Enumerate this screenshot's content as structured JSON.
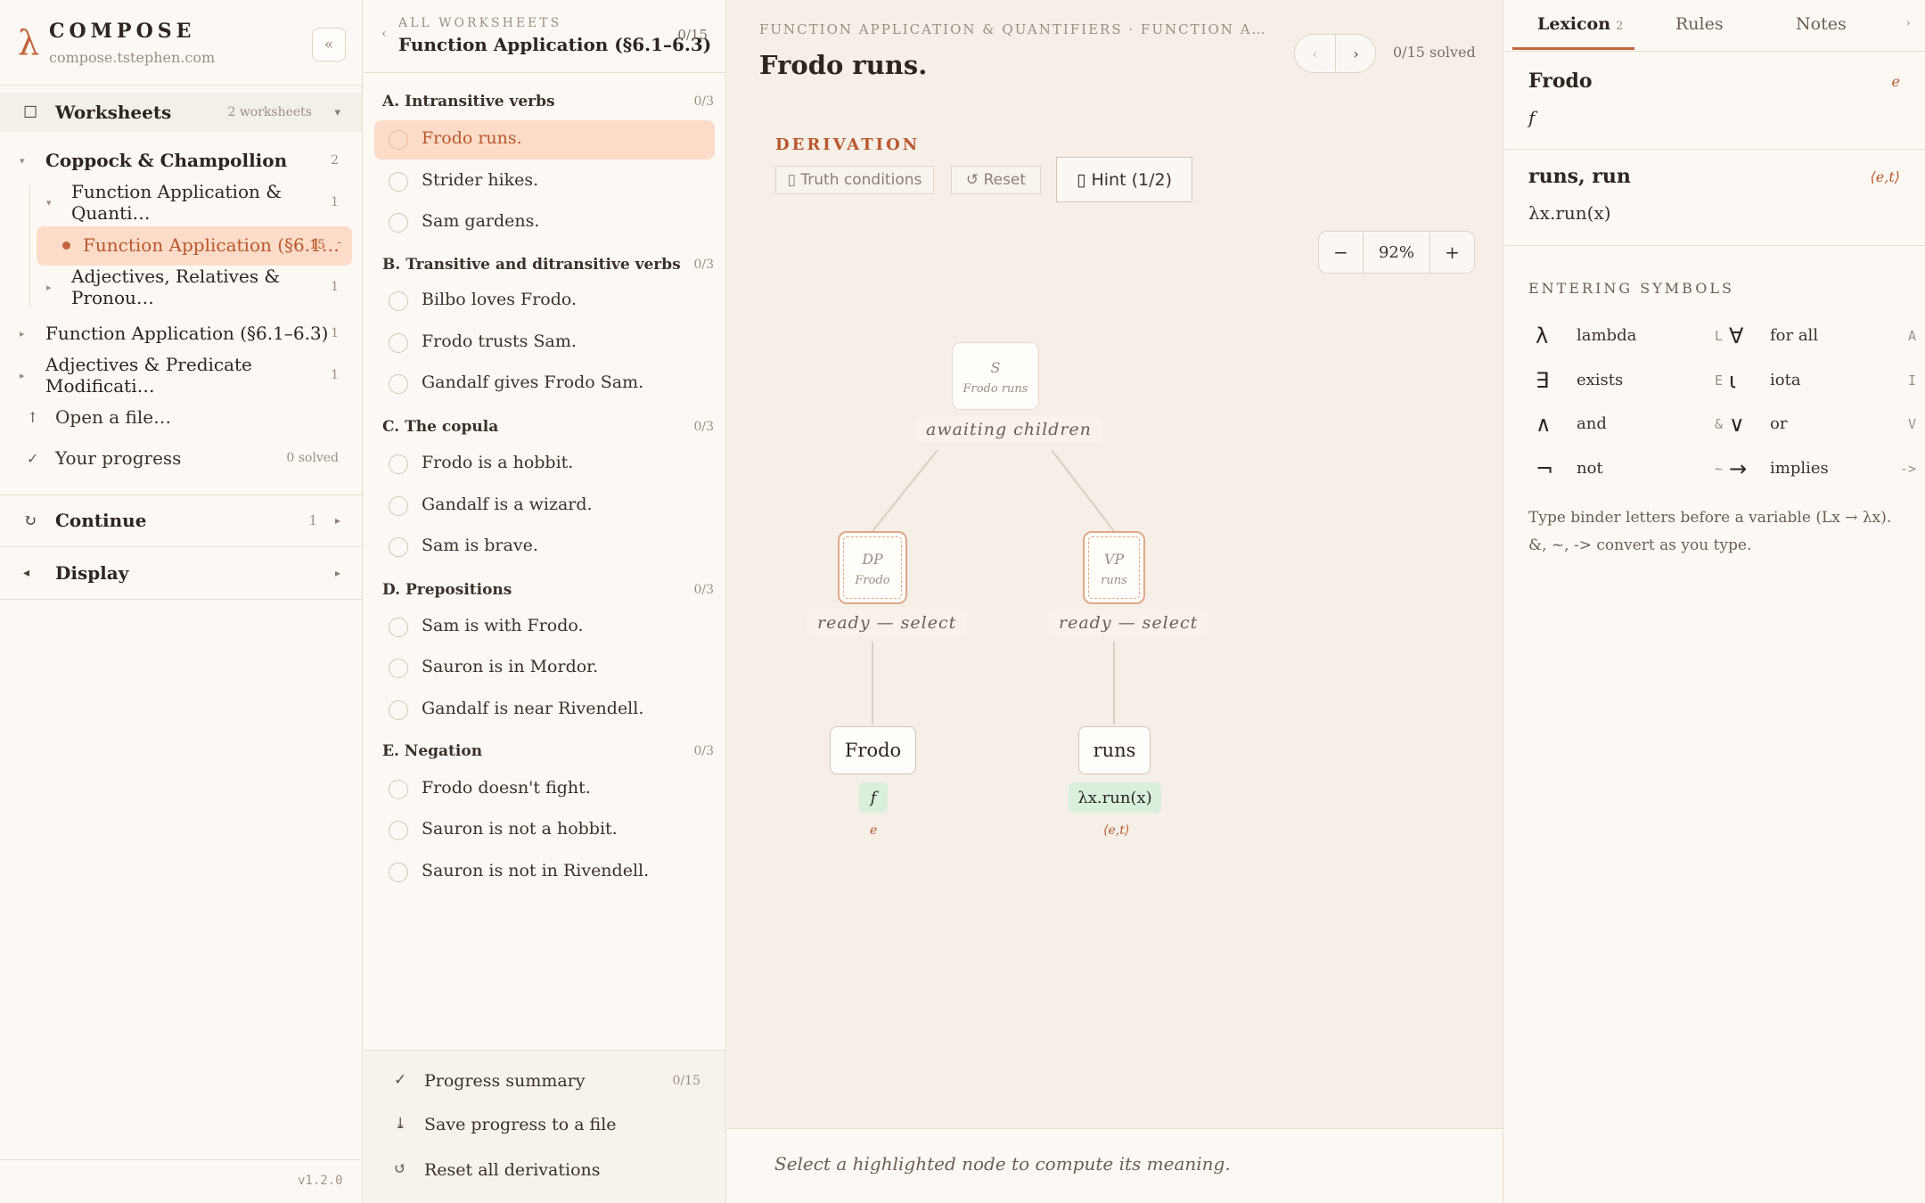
{
  "sidebar": {
    "brand": {
      "logo": "λ",
      "name": "COMPOSE",
      "url": "compose.tstephen.com",
      "collapse": "«"
    },
    "worksheets": {
      "icon": "☐",
      "label": "Worksheets",
      "count": "2 worksheets",
      "chevron": "▾"
    },
    "tree": {
      "book1": {
        "label": "Coppock & Champollion",
        "count": "2"
      },
      "chapter1": {
        "label": "Function Application & Quanti…",
        "count": "1"
      },
      "active": {
        "label": "Function Application (§6.1…",
        "count": "15",
        "dash": "-"
      },
      "chapter2": {
        "label": "Adjectives, Relatives & Pronou…",
        "count": "1"
      },
      "book2": {
        "label": "Function Application (§6.1–6.3)",
        "count": "1"
      },
      "book3": {
        "label": "Adjectives & Predicate Modificati…",
        "count": "1"
      }
    },
    "links": {
      "open": {
        "icon": "↑",
        "label": "Open a file…"
      },
      "progress": {
        "icon": "✓",
        "label": "Your progress",
        "count": "0 solved"
      }
    },
    "continue": {
      "icon": "↻",
      "label": "Continue",
      "count": "1",
      "chevron": "▸"
    },
    "display": {
      "icon": "◂",
      "label": "Display",
      "chevron": "▸"
    },
    "version": "v1.2.0"
  },
  "problems": {
    "header": {
      "back": "‹",
      "small": "ALL WORKSHEETS",
      "title": "Function Application (§6.1–6.3)",
      "count": "0/15"
    },
    "sections": [
      {
        "title": "A. Intransitive verbs",
        "count": "0/3",
        "items": [
          "Frodo runs.",
          "Strider hikes.",
          "Sam gardens."
        ]
      },
      {
        "title": "B. Transitive and ditransitive verbs",
        "count": "0/3",
        "items": [
          "Bilbo loves Frodo.",
          "Frodo trusts Sam.",
          "Gandalf gives Frodo Sam."
        ]
      },
      {
        "title": "C. The copula",
        "count": "0/3",
        "items": [
          "Frodo is a hobbit.",
          "Gandalf is a wizard.",
          "Sam is brave."
        ]
      },
      {
        "title": "D. Prepositions",
        "count": "0/3",
        "items": [
          "Sam is with Frodo.",
          "Sauron is in Mordor.",
          "Gandalf is near Rivendell."
        ]
      },
      {
        "title": "E. Negation",
        "count": "0/3",
        "items": [
          "Frodo doesn't fight.",
          "Sauron is not a hobbit.",
          "Sauron is not in Rivendell."
        ]
      }
    ],
    "footer": {
      "summary": {
        "icon": "✓",
        "label": "Progress summary",
        "count": "0/15"
      },
      "save": {
        "icon": "⤓",
        "label": "Save progress to a file"
      },
      "reset": {
        "icon": "↺",
        "label": "Reset all derivations"
      }
    }
  },
  "main": {
    "breadcrumb": "FUNCTION APPLICATION & QUANTIFIERS · FUNCTION A…",
    "title": "Frodo runs.",
    "nav": {
      "prev": "‹",
      "next": "›"
    },
    "solved": "0/15 solved",
    "derivation_heading": "DERIVATION",
    "toolbar": {
      "truth": "▯ Truth conditions",
      "reset": "↺ Reset",
      "hint": "▯ Hint (1/2)"
    },
    "zoom": {
      "minus": "−",
      "value": "92%",
      "plus": "+"
    },
    "tree": {
      "s": {
        "cat": "S",
        "words": "Frodo runs",
        "status": "awaiting children"
      },
      "dp": {
        "cat": "DP",
        "words": "Frodo",
        "status": "ready — select"
      },
      "vp": {
        "cat": "VP",
        "words": "runs",
        "status": "ready — select"
      },
      "leaf_dp": {
        "word": "Frodo",
        "meaning": "f",
        "type": "e"
      },
      "leaf_vp": {
        "word": "runs",
        "meaning": "λx.run(x)",
        "type": "⟨e,t⟩"
      }
    },
    "message": "Select a highlighted node to compute its meaning."
  },
  "right": {
    "tabs": {
      "lexicon": "Lexicon",
      "lexicon_count": "2",
      "rules": "Rules",
      "notes": "Notes",
      "more": "›"
    },
    "lexicon": [
      {
        "word": "Frodo",
        "type": "e",
        "meaning": "f"
      },
      {
        "word": "runs, run",
        "type": "⟨e,t⟩",
        "meaning": "λx.run(x)"
      }
    ],
    "symbols_heading": "ENTERING SYMBOLS",
    "symbols": [
      {
        "glyph": "λ",
        "name": "lambda",
        "key": "L"
      },
      {
        "glyph": "∀",
        "name": "for all",
        "key": "A"
      },
      {
        "glyph": "∃",
        "name": "exists",
        "key": "E"
      },
      {
        "glyph": "ι",
        "name": "iota",
        "key": "I"
      },
      {
        "glyph": "∧",
        "name": "and",
        "key": "&"
      },
      {
        "glyph": "∨",
        "name": "or",
        "key": "V"
      },
      {
        "glyph": "¬",
        "name": "not",
        "key": "~"
      },
      {
        "glyph": "→",
        "name": "implies",
        "key": "->"
      }
    ],
    "symbols_note": "Type binder letters before a variable (Lx → λx). &, ~, -> convert as you type."
  },
  "colors": {
    "accent": "#c2653a",
    "selected_bg": "#fcdcc8",
    "meaning_bg": "#d8efdc"
  }
}
